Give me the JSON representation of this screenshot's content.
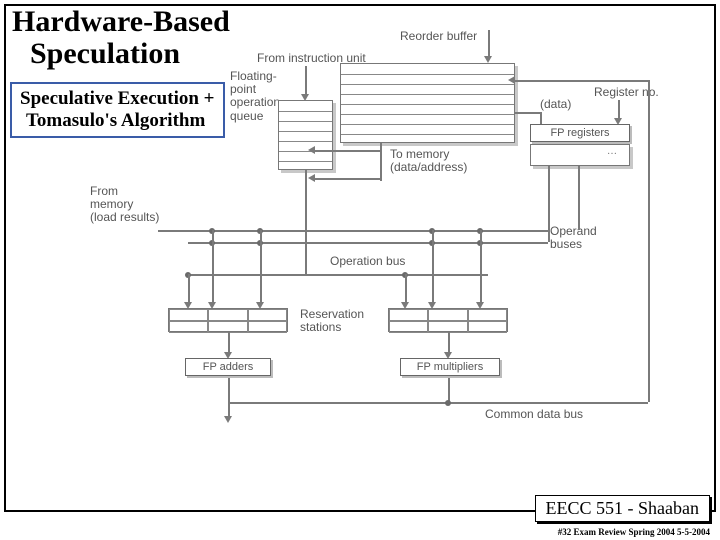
{
  "title_line1": "Hardware-Based",
  "title_line2": "Speculation",
  "subtitle_line1": "Speculative Execution +",
  "subtitle_line2": "Tomasulo's Algorithm",
  "footer": "EECC 551 - Shaaban",
  "footer_sub": "#32  Exam Review  Spring 2004  5-5-2004",
  "labels": {
    "reorder_buffer": "Reorder buffer",
    "from_instruction_unit": "From instruction unit",
    "fp_op_queue_l1": "Floating-",
    "fp_op_queue_l2": "point",
    "fp_op_queue_l3": "operation",
    "fp_op_queue_l4": "queue",
    "data": "(data)",
    "register_no": "Register no.",
    "fp_registers": "FP registers",
    "to_memory_l1": "To memory",
    "to_memory_l2": "(data/address)",
    "from_memory_l1": "From",
    "from_memory_l2": "memory",
    "from_memory_l3": "(load results)",
    "operand_buses_l1": "Operand",
    "operand_buses_l2": "buses",
    "operation_bus": "Operation bus",
    "reservation_stations_l1": "Reservation",
    "reservation_stations_l2": "stations",
    "fp_adders": "FP adders",
    "fp_multipliers": "FP multipliers",
    "common_data_bus": "Common data bus"
  }
}
